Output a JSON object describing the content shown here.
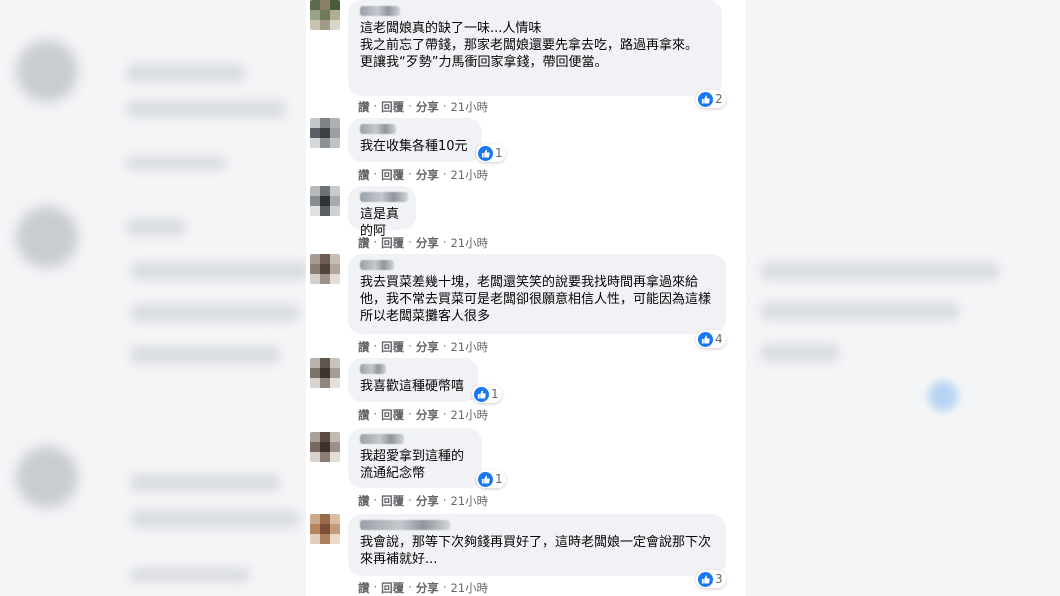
{
  "comments": [
    {
      "text": "這老闆娘真的缺了一味...人情味\n我之前忘了帶錢，那家老闆娘還要先拿去吃，路過再拿來。\n更讓我“歹勢”力馬衝回家拿錢，帶回便當。",
      "reactions": "2",
      "actions": {
        "like": "讚",
        "reply": "回覆",
        "share": "分享",
        "time": "21小時"
      }
    },
    {
      "text": "我在收集各種10元",
      "reactions": "1",
      "actions": {
        "like": "讚",
        "reply": "回覆",
        "share": "分享",
        "time": "21小時"
      }
    },
    {
      "text": "這是真的阿",
      "reactions": "",
      "actions": {
        "like": "讚",
        "reply": "回覆",
        "share": "分享",
        "time": "21小時"
      }
    },
    {
      "text": "我去買菜差幾十塊，老闆還笑笑的說要我找時間再拿過來給他，我不常去買菜可是老闆卻很願意相信人性，可能因為這樣所以老闆菜攤客人很多",
      "reactions": "4",
      "actions": {
        "like": "讚",
        "reply": "回覆",
        "share": "分享",
        "time": "21小時"
      }
    },
    {
      "text": "我喜歡這種硬幣嘻",
      "reactions": "1",
      "actions": {
        "like": "讚",
        "reply": "回覆",
        "share": "分享",
        "time": "21小時"
      }
    },
    {
      "text": "我超愛拿到這種的\n流通紀念幣",
      "reactions": "1",
      "actions": {
        "like": "讚",
        "reply": "回覆",
        "share": "分享",
        "time": "21小時"
      }
    },
    {
      "text": "我會說，那等下次夠錢再買好了，這時老闆娘一定會說那下次來再補就好...",
      "reactions": "3",
      "actions": {
        "like": "讚",
        "reply": "回覆",
        "share": "分享",
        "time": "21小時"
      }
    }
  ],
  "colors": {
    "bubble": "#f0f2f5",
    "like_blue": "#1877f2",
    "meta_text": "#65676b"
  },
  "icons": {
    "reaction": "thumbs-up-icon"
  }
}
